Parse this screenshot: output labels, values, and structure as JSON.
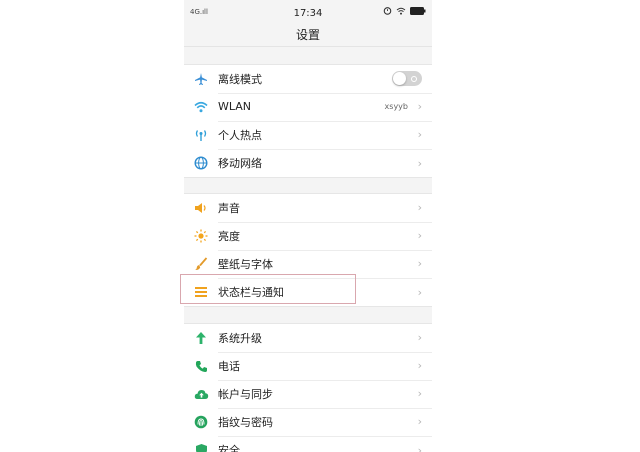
{
  "status_bar": {
    "signal": "4G.ıll",
    "time": "17:34"
  },
  "header": {
    "title": "设置"
  },
  "groups": [
    {
      "items": [
        {
          "label": "离线模式",
          "icon": "airplane-icon",
          "control": "toggle",
          "toggle_on": false
        },
        {
          "label": "WLAN",
          "icon": "wifi-icon",
          "value": "xsyyb",
          "control": "chevron"
        },
        {
          "label": "个人热点",
          "icon": "hotspot-icon",
          "control": "chevron"
        },
        {
          "label": "移动网络",
          "icon": "globe-icon",
          "control": "chevron"
        }
      ]
    },
    {
      "items": [
        {
          "label": "声音",
          "icon": "speaker-icon",
          "control": "chevron"
        },
        {
          "label": "亮度",
          "icon": "sun-icon",
          "control": "chevron"
        },
        {
          "label": "壁纸与字体",
          "icon": "brush-icon",
          "control": "chevron"
        },
        {
          "label": "状态栏与通知",
          "icon": "list-icon",
          "control": "chevron",
          "highlighted": true
        }
      ]
    },
    {
      "items": [
        {
          "label": "系统升级",
          "icon": "arrow-up-icon",
          "control": "chevron"
        },
        {
          "label": "电话",
          "icon": "phone-icon",
          "control": "chevron"
        },
        {
          "label": "帐户与同步",
          "icon": "cloud-icon",
          "control": "chevron"
        },
        {
          "label": "指纹与密码",
          "icon": "fingerprint-icon",
          "control": "chevron"
        },
        {
          "label": "安全",
          "icon": "shield-icon",
          "control": "chevron"
        }
      ]
    }
  ],
  "chevron": "›",
  "colors": {
    "airplane": "#3a8fd6",
    "wifi": "#39a8e0",
    "hotspot": "#2f9fd8",
    "globe": "#2e8ccf",
    "speaker": "#f0a21e",
    "sun": "#f3a51d",
    "brush": "#e39a2a",
    "list": "#f0a21e",
    "arrow_up": "#2db36b",
    "phone": "#22a65a",
    "cloud": "#2aa863",
    "fingerprint": "#25a35d",
    "shield": "#2aa863",
    "highlight_border": "#d9a7ae"
  }
}
